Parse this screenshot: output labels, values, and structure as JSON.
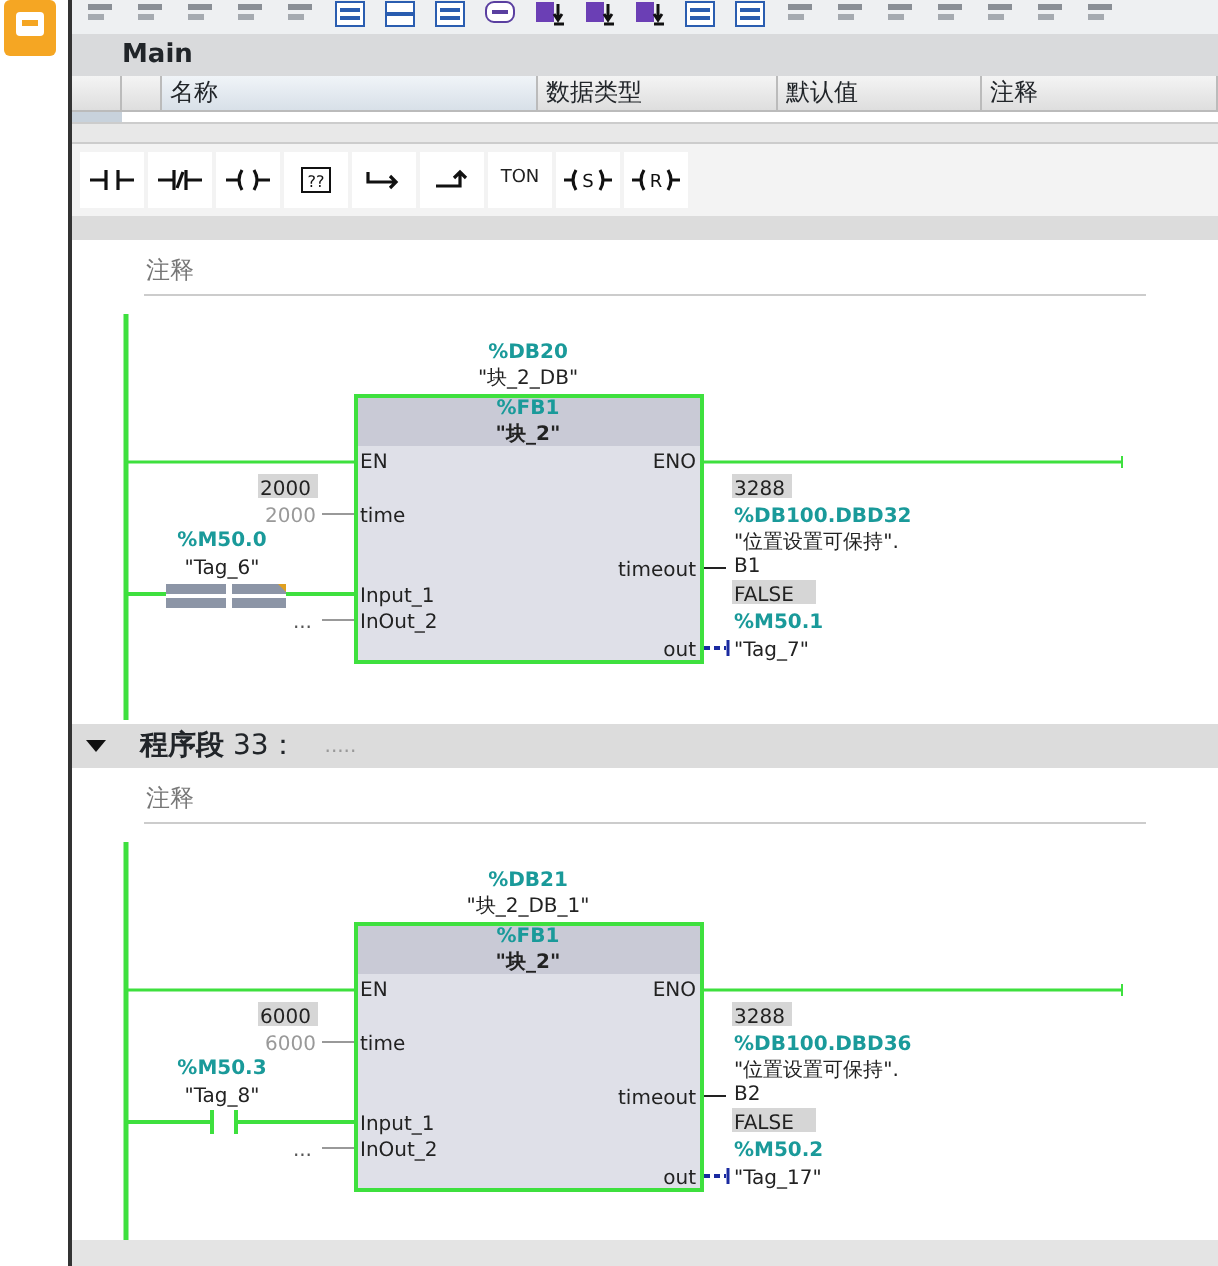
{
  "editor_title": "Main",
  "interface_table": {
    "columns": [
      "名称",
      "数据类型",
      "默认值",
      "注释"
    ]
  },
  "instructions": [
    {
      "kind": "no-contact"
    },
    {
      "kind": "nc-contact"
    },
    {
      "kind": "coil"
    },
    {
      "kind": "empty-box",
      "label": "??"
    },
    {
      "kind": "open-branch"
    },
    {
      "kind": "close-branch"
    },
    {
      "kind": "box",
      "label": "TON"
    },
    {
      "kind": "set-coil",
      "label": "S"
    },
    {
      "kind": "reset-coil",
      "label": "R"
    }
  ],
  "networks": [
    {
      "comment": "注释",
      "block": {
        "instance_address": "%DB20",
        "instance_name": "\"块_2_DB\"",
        "fb_address": "%FB1",
        "fb_name": "\"块_2\"",
        "en": "EN",
        "eno": "ENO",
        "inputs": [
          {
            "kind": "parameter",
            "pin": "time",
            "monitor": "2000",
            "value": "2000"
          },
          {
            "kind": "unresolved-contact",
            "pin": "Input_1",
            "address": "%M50.0",
            "tag": "\"Tag_6\""
          },
          {
            "kind": "parameter",
            "pin": "InOut_2",
            "value": "..."
          }
        ],
        "outputs": [
          {
            "pin": "timeout",
            "monitor": "3288",
            "address": "%DB100.DBD32",
            "tag": "\"位置设置可保持\".",
            "member": "B1"
          },
          {
            "pin": "out",
            "monitor": "FALSE",
            "address": "%M50.1",
            "tag": "\"Tag_7\""
          }
        ]
      }
    },
    {
      "title": "**程序段** 33：",
      "title_hint": ".....",
      "expanded": true,
      "comment": "注释",
      "block": {
        "instance_address": "%DB21",
        "instance_name": "\"块_2_DB_1\"",
        "fb_address": "%FB1",
        "fb_name": "\"块_2\"",
        "en": "EN",
        "eno": "ENO",
        "inputs": [
          {
            "kind": "parameter",
            "pin": "time",
            "monitor": "6000",
            "value": "6000"
          },
          {
            "kind": "contact",
            "pin": "Input_1",
            "address": "%M50.3",
            "tag": "\"Tag_8\""
          },
          {
            "kind": "parameter",
            "pin": "InOut_2",
            "value": "..."
          }
        ],
        "outputs": [
          {
            "pin": "timeout",
            "monitor": "3288",
            "address": "%DB100.DBD36",
            "tag": "\"位置设置可保持\".",
            "member": "B2"
          },
          {
            "pin": "out",
            "monitor": "FALSE",
            "address": "%M50.2",
            "tag": "\"Tag_17\""
          }
        ]
      }
    }
  ]
}
